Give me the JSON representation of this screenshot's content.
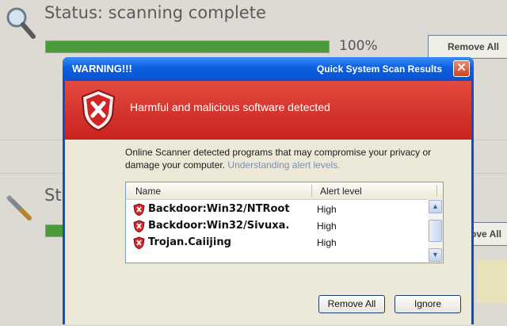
{
  "background": {
    "status_text_1": "Status: scanning complete",
    "progress_1": {
      "value_percent": 100,
      "label": "100%"
    },
    "remove_button_1": "Remove All",
    "status_text_2": "St",
    "remove_button_2": "ove All",
    "icons": [
      "magnifier-icon",
      "wrench-icon"
    ]
  },
  "dialog": {
    "title": "WARNING!!!",
    "title_right": "Quick System Scan Results",
    "close_glyph": "✕",
    "banner_text": "Harmful and malicious software detected",
    "info_text": "Online Scanner detected programs that may compromise your privacy or damage your computer.",
    "info_link": "Understanding alert levels.",
    "list": {
      "columns": [
        "Name",
        "Alert level"
      ],
      "rows": [
        {
          "name": "Backdoor:Win32/NTRoot",
          "level": "High"
        },
        {
          "name": "Backdoor:Win32/Sivuxa.",
          "level": "High"
        },
        {
          "name": "Trojan.Caiijing",
          "level": "High"
        }
      ]
    },
    "buttons": {
      "remove_all": "Remove All",
      "ignore": "Ignore"
    }
  },
  "colors": {
    "title_bar": "#0a52cf",
    "banner_red": "#d3302a",
    "progress_green": "#4a9b3a"
  }
}
